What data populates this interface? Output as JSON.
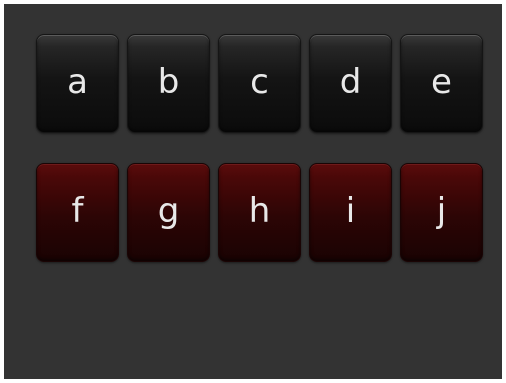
{
  "keyboard": {
    "row1": [
      "a",
      "b",
      "c",
      "d",
      "e"
    ],
    "row2": [
      "f",
      "g",
      "h",
      "i",
      "j"
    ]
  },
  "colors": {
    "background": "#333333",
    "key_dark": "#141414",
    "key_red": "#3a0606",
    "text": "#e8e8e8"
  }
}
